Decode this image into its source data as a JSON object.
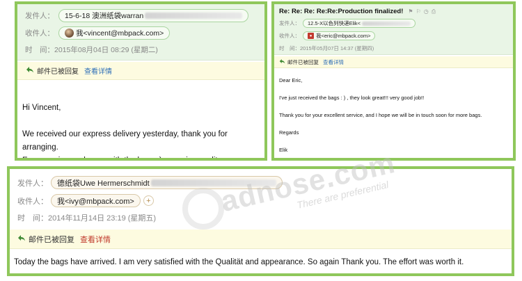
{
  "panel1": {
    "from_label": "发件人：",
    "from_value": "15-6-18 澳洲纸袋warran",
    "to_label": "收件人：",
    "to_value": "我<vincent@mbpack.com>",
    "time_label": "时　间：",
    "time_value": "2015年08月04日 08:29 (星期二)",
    "replied_label": "邮件已被回复",
    "detail_link": "查看详情",
    "body": [
      "Hi Vincent,",
      "",
      "We received our express delivery yesterday, thank you for arranging.",
      "Everyone is very happy with the bags :) very nice quality."
    ]
  },
  "panel2": {
    "subject": "Re: Re: Re: Re:Re:Production finalized!",
    "from_label": "发件人：",
    "from_value": "12.5-X以色列快递Elik<",
    "to_label": "收件人：",
    "to_value": "我<eric@mbpack.com>",
    "time_label": "时　间：",
    "time_value": "2015年05月07日 14:37 (星期四)",
    "replied_label": "邮件已被回复",
    "detail_link": "查看详情",
    "body": [
      "Dear Eric,",
      "I've just received the bags : ) , they look great!!! very good job!!",
      "Thank you for your excellent service, and I hope we will be in touch soon for more bags.",
      "Regards",
      "Elik"
    ]
  },
  "panel3": {
    "from_label": "发件人：",
    "from_value": "德纸袋Uwe Hermerschmidt",
    "to_label": "收件人：",
    "to_value": "我<ivy@mbpack.com>",
    "time_label": "时　间：",
    "time_value": "2014年11月14日 23:19 (星期五)",
    "replied_label": "邮件已被回复",
    "detail_link": "查看详情",
    "body": "Today the bags have arrived.  I am very satisfied with the Qualität and appearance.  So again Thank you. The effort was worth it."
  },
  "watermark": {
    "main": "adnose.com",
    "sub": "There are preferential"
  },
  "colors": {
    "frame_green": "#8fc75b",
    "header_green": "#e9f5e6",
    "reply_bar": "#fdfbe0",
    "link_blue": "#2f6fb7",
    "link_red": "#c0392b"
  }
}
